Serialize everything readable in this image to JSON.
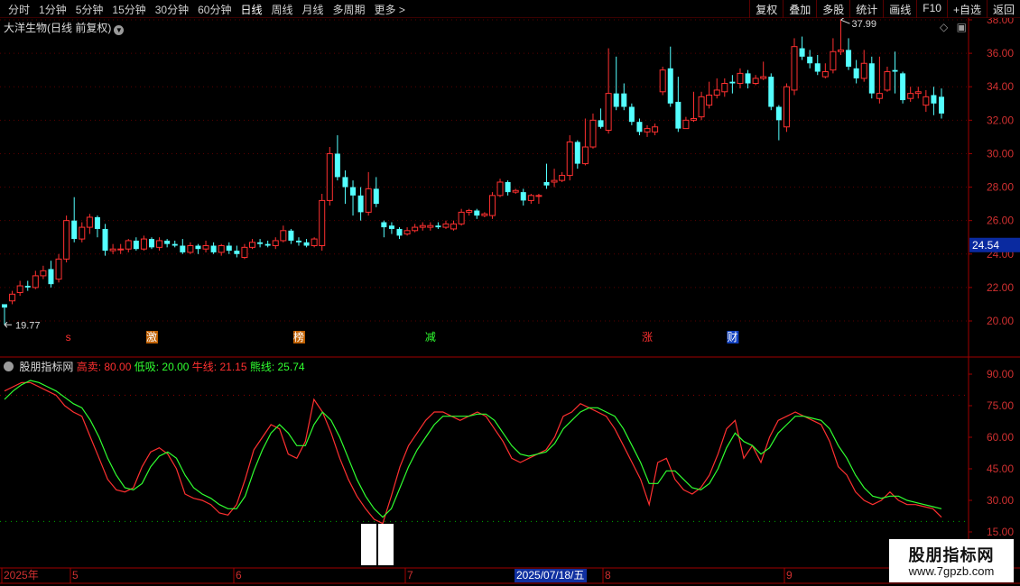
{
  "toolbar": {
    "periods": [
      "分时",
      "1分钟",
      "5分钟",
      "15分钟",
      "30分钟",
      "60分钟",
      "日线",
      "周线",
      "月线",
      "多周期",
      "更多 >"
    ],
    "active_period": "日线",
    "right_buttons": [
      "复权",
      "叠加",
      "多股",
      "统计",
      "画线",
      "F10",
      "+自选",
      "返回"
    ]
  },
  "main_chart": {
    "title": "大洋生物(日线 前复权)",
    "price_ticks": [
      "38.00",
      "36.00",
      "34.00",
      "32.00",
      "30.00",
      "28.00",
      "26.00",
      "24.00",
      "22.00",
      "20.00"
    ],
    "current_price": "24.54",
    "high_label": "37.99",
    "low_label": "19.77",
    "event_marks": [
      {
        "text": "s",
        "color": "#ff3030"
      },
      {
        "text": "激",
        "color": "#ffffff",
        "bg": "#c06000"
      },
      {
        "text": "榜",
        "color": "#ffffff",
        "bg": "#c06000"
      },
      {
        "text": "减",
        "color": "#30ff30"
      },
      {
        "text": "涨",
        "color": "#ff3030"
      },
      {
        "text": "财",
        "color": "#ffffff",
        "bg": "#1040c0"
      }
    ]
  },
  "indicator": {
    "name": "股朋指标网",
    "sell_label": "高卖: 80.00",
    "buy_label": "低吸: 20.00",
    "bull_label": "牛线: 21.15",
    "bear_label": "熊线: 25.74",
    "ticks": [
      "90.00",
      "75.00",
      "60.00",
      "45.00",
      "30.00",
      "15.00"
    ]
  },
  "time_axis": {
    "labels": [
      "2025年",
      "5",
      "6",
      "7",
      "8",
      "9"
    ],
    "selected_date": "2025/07/18/五"
  },
  "watermark": {
    "title": "股朋指标网",
    "url": "www.7gpzb.com"
  },
  "chart_data": [
    {
      "type": "candlestick",
      "title": "大洋生物(日线 前复权)",
      "ylim": [
        19.5,
        38.5
      ],
      "up_color": "#ff3030",
      "down_color": "#54ffff",
      "ohlc": [
        [
          21.0,
          20.8,
          21.0,
          19.77
        ],
        [
          21.2,
          21.6,
          21.8,
          21.0
        ],
        [
          21.7,
          22.1,
          22.4,
          21.5
        ],
        [
          22.1,
          22.0,
          22.4,
          21.8
        ],
        [
          22.0,
          22.7,
          23.0,
          21.9
        ],
        [
          22.7,
          23.0,
          23.3,
          22.5
        ],
        [
          23.1,
          22.2,
          23.6,
          22.0
        ],
        [
          22.5,
          23.7,
          24.0,
          22.3
        ],
        [
          23.7,
          26.0,
          26.3,
          23.5
        ],
        [
          26.0,
          24.9,
          27.4,
          24.7
        ],
        [
          24.9,
          25.6,
          25.9,
          24.7
        ],
        [
          25.6,
          26.2,
          26.4,
          25.2
        ],
        [
          26.2,
          25.5,
          26.3,
          25.0
        ],
        [
          25.5,
          24.2,
          25.8,
          23.9
        ],
        [
          24.2,
          24.3,
          24.6,
          24.0
        ],
        [
          24.3,
          24.3,
          24.6,
          24.0
        ],
        [
          24.3,
          24.8,
          24.9,
          24.1
        ],
        [
          24.8,
          24.3,
          25.0,
          24.2
        ],
        [
          24.3,
          24.9,
          25.1,
          24.2
        ],
        [
          24.9,
          24.4,
          25.0,
          24.3
        ],
        [
          24.4,
          24.8,
          25.0,
          24.2
        ],
        [
          24.8,
          24.6,
          24.9,
          24.4
        ],
        [
          24.6,
          24.5,
          24.8,
          24.4
        ],
        [
          24.5,
          24.1,
          24.9,
          24.0
        ],
        [
          24.1,
          24.5,
          24.7,
          24.0
        ],
        [
          24.5,
          24.3,
          24.6,
          24.0
        ],
        [
          24.3,
          24.5,
          24.8,
          24.1
        ],
        [
          24.5,
          24.1,
          24.7,
          24.0
        ],
        [
          24.1,
          24.5,
          24.6,
          23.9
        ],
        [
          24.5,
          24.2,
          24.7,
          24.0
        ],
        [
          24.2,
          24.0,
          24.5,
          23.8
        ],
        [
          23.8,
          24.4,
          24.6,
          23.7
        ],
        [
          24.4,
          24.7,
          24.9,
          24.3
        ],
        [
          24.7,
          24.6,
          24.9,
          24.4
        ],
        [
          24.6,
          24.5,
          24.8,
          24.4
        ],
        [
          24.5,
          24.8,
          25.0,
          24.3
        ],
        [
          24.8,
          25.4,
          25.7,
          24.7
        ],
        [
          25.4,
          24.8,
          25.5,
          24.6
        ],
        [
          24.8,
          24.7,
          25.0,
          24.5
        ],
        [
          24.7,
          24.5,
          24.9,
          24.4
        ],
        [
          24.5,
          24.9,
          25.0,
          24.4
        ],
        [
          24.5,
          27.2,
          27.6,
          24.2
        ],
        [
          27.2,
          30.0,
          30.4,
          26.9
        ],
        [
          30.0,
          28.6,
          31.1,
          28.4
        ],
        [
          28.6,
          28.0,
          29.0,
          27.0
        ],
        [
          28.0,
          27.5,
          28.4,
          26.3
        ],
        [
          27.5,
          26.5,
          28.0,
          26.0
        ],
        [
          26.5,
          27.9,
          28.9,
          26.3
        ],
        [
          27.9,
          27.0,
          28.6,
          26.8
        ],
        [
          25.9,
          25.6,
          26.0,
          25.0
        ],
        [
          25.7,
          25.5,
          25.9,
          25.2
        ],
        [
          25.5,
          25.1,
          25.6,
          24.9
        ],
        [
          25.2,
          25.4,
          25.6,
          25.1
        ],
        [
          25.4,
          25.6,
          25.8,
          25.3
        ],
        [
          25.6,
          25.7,
          25.9,
          25.4
        ],
        [
          25.6,
          25.7,
          25.9,
          25.4
        ],
        [
          25.7,
          25.6,
          25.9,
          25.5
        ],
        [
          25.6,
          25.8,
          26.0,
          25.5
        ],
        [
          25.5,
          25.8,
          26.0,
          25.4
        ],
        [
          25.8,
          26.5,
          26.7,
          25.7
        ],
        [
          26.5,
          26.6,
          26.7,
          26.3
        ],
        [
          26.6,
          26.3,
          26.7,
          26.1
        ],
        [
          26.3,
          26.4,
          26.5,
          26.2
        ],
        [
          26.3,
          27.5,
          27.7,
          26.1
        ],
        [
          27.5,
          28.3,
          28.5,
          27.4
        ],
        [
          28.3,
          27.7,
          28.4,
          27.5
        ],
        [
          27.7,
          27.8,
          27.9,
          27.6
        ],
        [
          27.7,
          27.2,
          27.9,
          26.9
        ],
        [
          27.2,
          27.5,
          27.6,
          27.0
        ],
        [
          27.5,
          27.5,
          27.6,
          27.0
        ],
        [
          28.3,
          28.1,
          29.4,
          27.9
        ],
        [
          28.3,
          28.4,
          29.1,
          28.0
        ],
        [
          28.4,
          28.7,
          28.9,
          28.3
        ],
        [
          28.7,
          30.7,
          31.1,
          28.4
        ],
        [
          30.7,
          29.4,
          30.8,
          29.1
        ],
        [
          29.4,
          30.4,
          32.1,
          29.3
        ],
        [
          30.4,
          32.0,
          32.4,
          30.3
        ],
        [
          32.0,
          31.6,
          32.7,
          31.5
        ],
        [
          31.4,
          33.6,
          36.3,
          31.2
        ],
        [
          33.6,
          32.8,
          35.8,
          32.6
        ],
        [
          33.6,
          32.8,
          34.2,
          32.6
        ],
        [
          32.8,
          31.9,
          33.0,
          31.7
        ],
        [
          31.9,
          31.3,
          32.1,
          31.1
        ],
        [
          31.3,
          31.5,
          31.7,
          31.0
        ],
        [
          31.3,
          31.6,
          31.8,
          31.1
        ],
        [
          33.7,
          35.0,
          35.2,
          33.5
        ],
        [
          35.1,
          33.0,
          36.4,
          32.8
        ],
        [
          33.1,
          31.5,
          34.6,
          31.3
        ],
        [
          31.5,
          32.0,
          32.2,
          31.9
        ],
        [
          32.0,
          32.1,
          33.7,
          31.9
        ],
        [
          32.2,
          33.4,
          33.7,
          32.0
        ],
        [
          32.9,
          33.5,
          34.3,
          32.7
        ],
        [
          33.5,
          33.8,
          34.5,
          33.3
        ],
        [
          33.7,
          34.2,
          34.5,
          33.4
        ],
        [
          34.3,
          34.2,
          34.7,
          33.6
        ],
        [
          34.2,
          34.8,
          35.1,
          33.9
        ],
        [
          34.8,
          34.2,
          35.0,
          33.9
        ],
        [
          34.2,
          34.5,
          34.7,
          34.1
        ],
        [
          34.5,
          34.6,
          35.5,
          34.4
        ],
        [
          34.6,
          32.8,
          34.8,
          32.6
        ],
        [
          32.8,
          32.0,
          32.9,
          30.8
        ],
        [
          31.6,
          34.0,
          34.2,
          31.3
        ],
        [
          33.8,
          36.4,
          36.9,
          33.5
        ],
        [
          36.3,
          35.8,
          37.0,
          35.6
        ],
        [
          35.8,
          35.4,
          36.2,
          35.1
        ],
        [
          35.4,
          34.9,
          35.9,
          34.7
        ],
        [
          34.6,
          34.9,
          35.4,
          34.5
        ],
        [
          35.0,
          36.1,
          36.9,
          34.8
        ],
        [
          36.1,
          36.2,
          37.99,
          35.9
        ],
        [
          36.2,
          35.2,
          36.9,
          35.0
        ],
        [
          35.1,
          34.5,
          35.6,
          34.2
        ],
        [
          34.5,
          35.4,
          36.2,
          34.3
        ],
        [
          35.4,
          33.6,
          35.8,
          33.3
        ],
        [
          33.3,
          33.6,
          35.8,
          33.0
        ],
        [
          33.8,
          34.9,
          35.2,
          33.7
        ],
        [
          35.0,
          34.9,
          36.1,
          33.6
        ],
        [
          34.8,
          33.2,
          34.9,
          33.0
        ],
        [
          33.3,
          33.6,
          34.0,
          33.1
        ],
        [
          33.6,
          33.7,
          34.0,
          33.3
        ],
        [
          32.9,
          33.4,
          33.8,
          32.5
        ],
        [
          33.5,
          33.0,
          34.0,
          32.3
        ],
        [
          33.4,
          32.4,
          33.9,
          32.1
        ]
      ]
    },
    {
      "type": "line",
      "title": "股朋指标网",
      "ylim": [
        10,
        98
      ],
      "guide_lines": [
        80,
        20
      ],
      "series": [
        {
          "name": "牛线",
          "color": "#ff3030",
          "values": [
            82,
            84,
            86,
            86,
            84,
            82,
            80,
            75,
            72,
            70,
            60,
            50,
            40,
            35,
            34,
            36,
            46,
            53,
            55,
            52,
            45,
            33,
            31,
            30,
            28,
            24,
            23,
            28,
            40,
            54,
            60,
            66,
            64,
            52,
            50,
            58,
            78,
            72,
            62,
            50,
            40,
            32,
            26,
            21,
            19,
            32,
            46,
            56,
            62,
            68,
            72,
            72,
            70,
            68,
            70,
            72,
            70,
            64,
            58,
            50,
            48,
            50,
            52,
            54,
            60,
            70,
            72,
            76,
            74,
            72,
            70,
            64,
            56,
            48,
            40,
            28,
            48,
            50,
            40,
            35,
            33,
            36,
            42,
            52,
            64,
            68,
            50,
            56,
            48,
            60,
            68,
            70,
            72,
            70,
            68,
            66,
            58,
            46,
            42,
            34,
            30,
            28,
            30,
            34,
            30,
            28,
            28,
            27,
            26,
            22
          ]
        },
        {
          "name": "熊线",
          "color": "#30ff30",
          "values": [
            78,
            82,
            85,
            87,
            86,
            84,
            82,
            79,
            76,
            74,
            68,
            60,
            50,
            42,
            36,
            35,
            38,
            46,
            51,
            53,
            50,
            42,
            36,
            33,
            31,
            28,
            26,
            26,
            32,
            44,
            54,
            62,
            66,
            62,
            56,
            56,
            66,
            72,
            68,
            60,
            50,
            40,
            32,
            26,
            22,
            26,
            36,
            46,
            54,
            60,
            66,
            70,
            70,
            70,
            70,
            71,
            71,
            68,
            62,
            56,
            52,
            51,
            52,
            53,
            57,
            64,
            68,
            72,
            74,
            74,
            72,
            70,
            64,
            56,
            48,
            38,
            38,
            44,
            44,
            40,
            36,
            35,
            38,
            45,
            55,
            62,
            58,
            56,
            52,
            55,
            62,
            66,
            70,
            70,
            69,
            68,
            64,
            56,
            50,
            42,
            36,
            32,
            31,
            32,
            32,
            30,
            29,
            28,
            27,
            26
          ]
        }
      ]
    }
  ]
}
